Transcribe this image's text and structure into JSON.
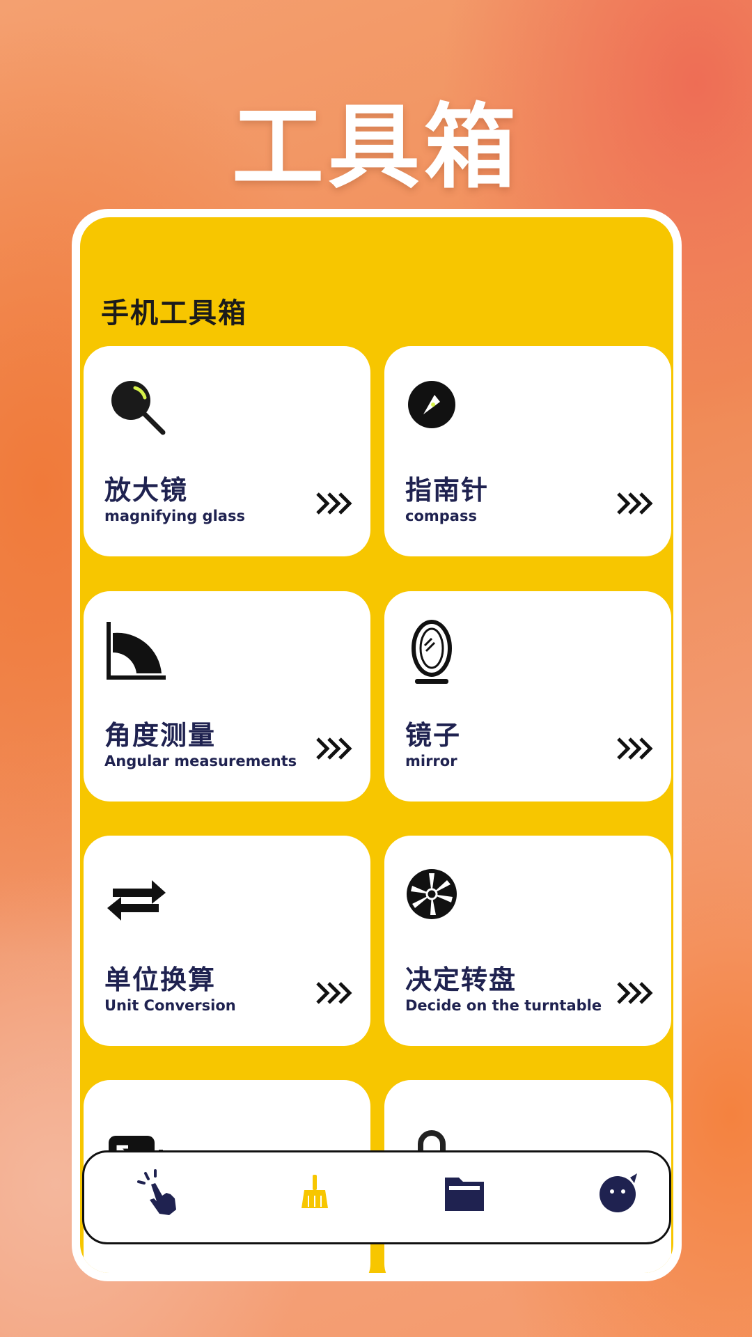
{
  "hero": {
    "title": "工具箱"
  },
  "screen": {
    "title": "手机工具箱"
  },
  "tools": [
    {
      "cn": "放大镜",
      "en": "magnifying glass",
      "icon": "magnifier-icon"
    },
    {
      "cn": "指南针",
      "en": "compass",
      "icon": "compass-icon"
    },
    {
      "cn": "角度测量",
      "en": "Angular measurements",
      "icon": "protractor-icon"
    },
    {
      "cn": "镜子",
      "en": "mirror",
      "icon": "mirror-icon"
    },
    {
      "cn": "单位换算",
      "en": "Unit Conversion",
      "icon": "swap-arrows-icon"
    },
    {
      "cn": "决定转盘",
      "en": "Decide on the turntable",
      "icon": "turntable-icon"
    }
  ],
  "bottom_nav": [
    {
      "icon": "tap-hand-icon",
      "active": false
    },
    {
      "icon": "broom-icon",
      "active": true
    },
    {
      "icon": "folder-icon",
      "active": false
    },
    {
      "icon": "chat-face-icon",
      "active": false
    }
  ],
  "colors": {
    "accent": "#f7c600",
    "text_dark": "#1f2250",
    "active_nav": "#f7c600"
  }
}
